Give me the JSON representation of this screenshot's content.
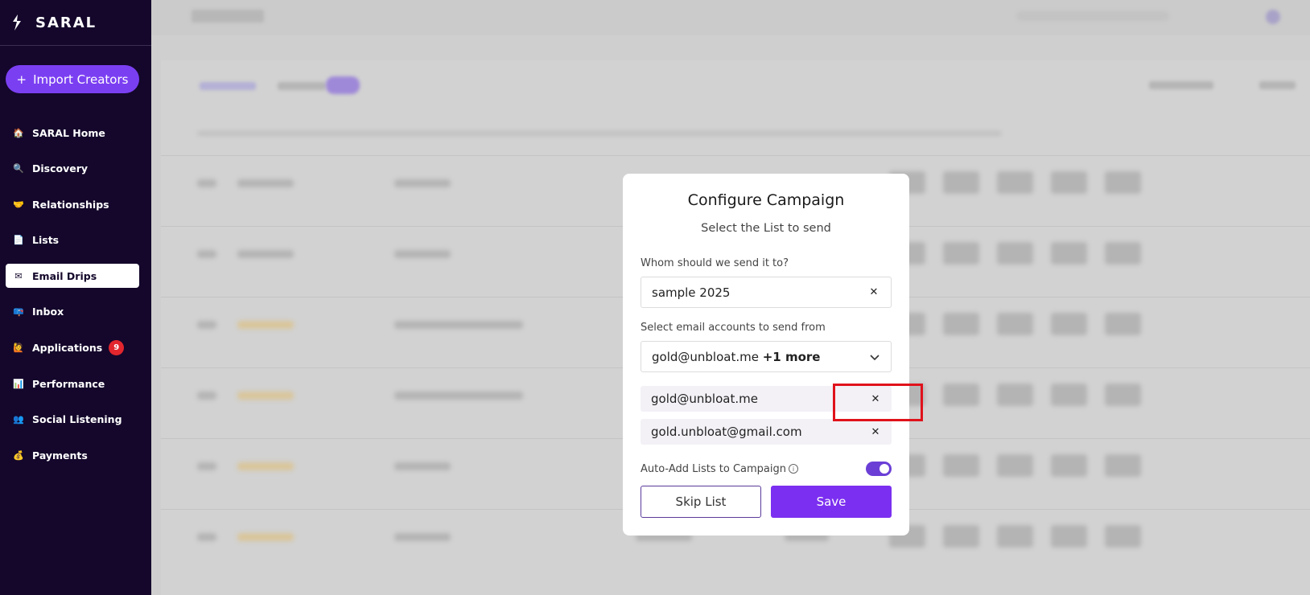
{
  "brand": {
    "name": "SARAL"
  },
  "sidebar": {
    "import_label": "Import Creators",
    "items": [
      {
        "label": "SARAL Home",
        "icon": "house-icon",
        "glyph": "🏠"
      },
      {
        "label": "Discovery",
        "icon": "magnifier-icon",
        "glyph": "🔍"
      },
      {
        "label": "Relationships",
        "icon": "handshake-icon",
        "glyph": "🤝"
      },
      {
        "label": "Lists",
        "icon": "document-icon",
        "glyph": "📄"
      },
      {
        "label": "Email Drips",
        "icon": "envelope-icon",
        "glyph": "✉"
      },
      {
        "label": "Inbox",
        "icon": "mailbox-icon",
        "glyph": "📪"
      },
      {
        "label": "Applications",
        "icon": "person-raising-hand-icon",
        "glyph": "🙋",
        "badge": "9"
      },
      {
        "label": "Performance",
        "icon": "bar-chart-icon",
        "glyph": "📊"
      },
      {
        "label": "Social Listening",
        "icon": "people-icon",
        "glyph": "👥"
      },
      {
        "label": "Payments",
        "icon": "money-bag-icon",
        "glyph": "💰"
      }
    ],
    "active_index": 4
  },
  "modal": {
    "title": "Configure Campaign",
    "subtitle": "Select the List to send",
    "recipient_label": "Whom should we send it to?",
    "recipient_value": "sample 2025",
    "sender_label": "Select email accounts to send from",
    "sender_value": "gold@unbloat.me",
    "sender_more": "+1 more",
    "selected_accounts": [
      "gold@unbloat.me",
      "gold.unbloat@gmail.com"
    ],
    "auto_add_label": "Auto-Add Lists to Campaign",
    "auto_add_enabled": true,
    "skip_label": "Skip List",
    "save_label": "Save"
  },
  "colors": {
    "sidebar_bg": "#14072b",
    "accent": "#7b2ff0",
    "badge": "#e3262e",
    "highlight": "#e0121b"
  }
}
